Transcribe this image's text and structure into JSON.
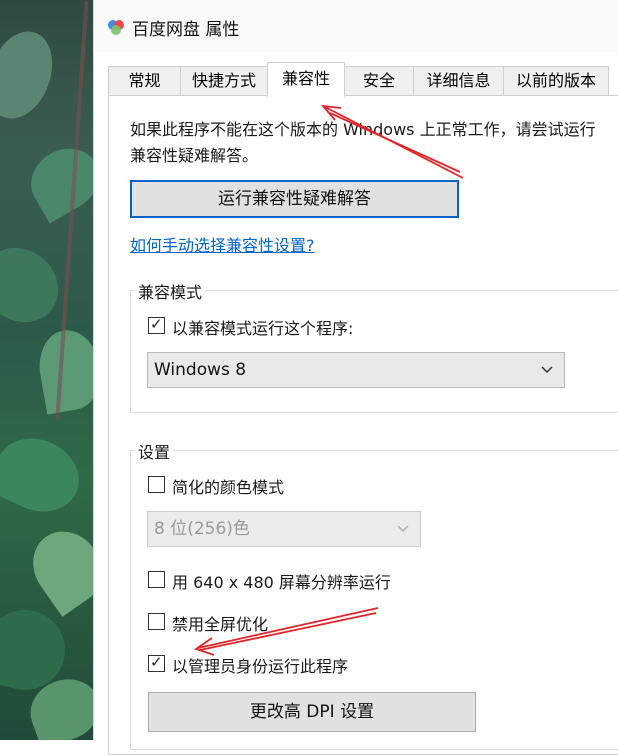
{
  "window": {
    "title": "百度网盘 属性",
    "icon": "baidu-netdisk-icon"
  },
  "tabs": [
    {
      "label": "常规"
    },
    {
      "label": "快捷方式"
    },
    {
      "label": "兼容性",
      "selected": true
    },
    {
      "label": "安全"
    },
    {
      "label": "详细信息"
    },
    {
      "label": "以前的版本"
    }
  ],
  "compat_page": {
    "description": "如果此程序不能在这个版本的 Windows 上正常工作，请尝试运行兼容性疑难解答。",
    "troubleshooter_button": "运行兼容性疑难解答",
    "manual_link": "如何手动选择兼容性设置?"
  },
  "compat_mode": {
    "group_label": "兼容模式",
    "checkbox_label": "以兼容模式运行这个程序:",
    "checked": true,
    "selected_os": "Windows 8"
  },
  "settings": {
    "group_label": "设置",
    "reduced_color_label": "简化的颜色模式",
    "reduced_color_checked": false,
    "color_depth_value": "8 位(256)色",
    "resolution_label": "用 640 x 480 屏幕分辨率运行",
    "resolution_checked": false,
    "disable_fullscreen_label": "禁用全屏优化",
    "disable_fullscreen_checked": false,
    "run_as_admin_label": "以管理员身份运行此程序",
    "run_as_admin_checked": true,
    "dpi_button": "更改高 DPI 设置"
  },
  "colors": {
    "accent": "#0a62c9",
    "link": "#0066cc",
    "annotation_arrow": "#e0262b"
  }
}
